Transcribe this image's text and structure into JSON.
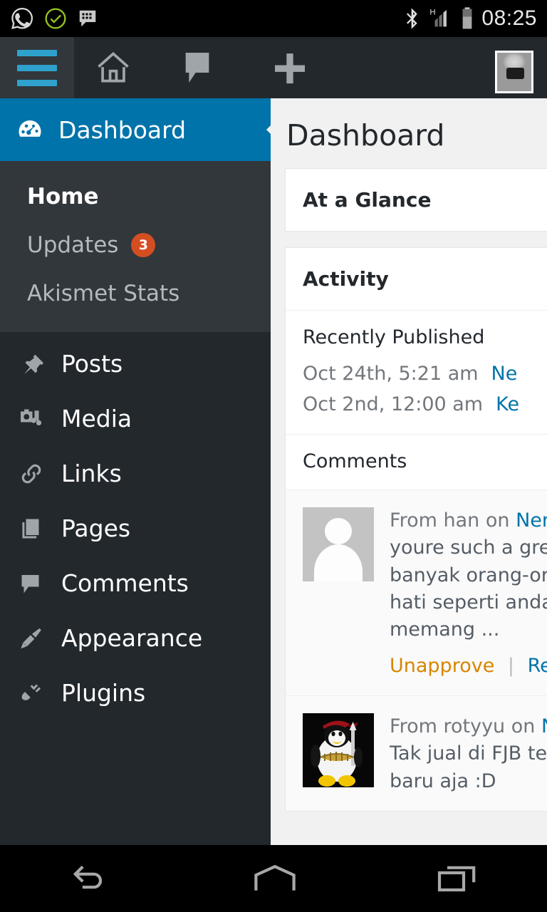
{
  "statusbar": {
    "time": "08:25",
    "left_icons": [
      "whatsapp-icon",
      "check-circle-icon",
      "bbm-icon"
    ],
    "right_icons": [
      "bluetooth-icon",
      "hsdpa-signal-icon",
      "battery-icon"
    ]
  },
  "adminbar": {
    "menu_toggle": "menu-toggle-icon",
    "icons": [
      "home-icon",
      "comment-icon",
      "plus-icon"
    ],
    "avatar": "user-avatar"
  },
  "sidebar": {
    "current": {
      "label": "Dashboard",
      "icon": "dashboard-gauge-icon"
    },
    "submenu": [
      {
        "label": "Home",
        "current": true
      },
      {
        "label": "Updates",
        "badge": "3"
      },
      {
        "label": "Akismet Stats"
      }
    ],
    "items": [
      {
        "label": "Posts",
        "icon": "pin-icon"
      },
      {
        "label": "Media",
        "icon": "media-icon"
      },
      {
        "label": "Links",
        "icon": "link-icon"
      },
      {
        "label": "Pages",
        "icon": "pages-icon"
      },
      {
        "label": "Comments",
        "icon": "comment-bubble-icon"
      },
      {
        "label": "Appearance",
        "icon": "paintbrush-icon"
      },
      {
        "label": "Plugins",
        "icon": "plug-icon"
      }
    ]
  },
  "main": {
    "page_title": "Dashboard",
    "at_a_glance": {
      "title": "At a Glance"
    },
    "activity": {
      "title": "Activity",
      "recently_published": {
        "title": "Recently Published",
        "posts": [
          {
            "date": "Oct 24th, 5:21 am",
            "title": "Ne"
          },
          {
            "date": "Oct 2nd, 12:00 am",
            "title": "Ke"
          }
        ]
      },
      "comments": {
        "title": "Comments",
        "items": [
          {
            "avatar": "mystery-person-avatar",
            "from_prefix": "From ",
            "author": "han",
            "on": " on ",
            "post": "Nem",
            "lines": [
              "youre such a grea",
              "banyak orang-ora",
              "hati seperti anda k",
              "memang ..."
            ],
            "actions": {
              "unapprove": "Unapprove",
              "separator": "|",
              "reply": "Repl"
            }
          },
          {
            "avatar": "tux-penguin-avatar",
            "from_prefix": "From ",
            "author": "rotyyu",
            "on": " on ",
            "post": "N",
            "lines": [
              "Tak jual di FJB teru",
              "baru aja :D"
            ]
          }
        ]
      }
    }
  },
  "navbar": {
    "buttons": [
      {
        "name": "back-button",
        "icon": "back-arrow-icon"
      },
      {
        "name": "home-button",
        "icon": "home-pentagon-icon"
      },
      {
        "name": "recents-button",
        "icon": "recents-icon"
      }
    ]
  },
  "colors": {
    "wp_blue": "#0073aa",
    "admin_dark": "#23282d",
    "submenu_dark": "#32373c",
    "badge_orange": "#d54e21",
    "toggle_blue": "#2ea2cc",
    "unapprove_orange": "#d98500",
    "content_bg": "#f1f1f1"
  }
}
